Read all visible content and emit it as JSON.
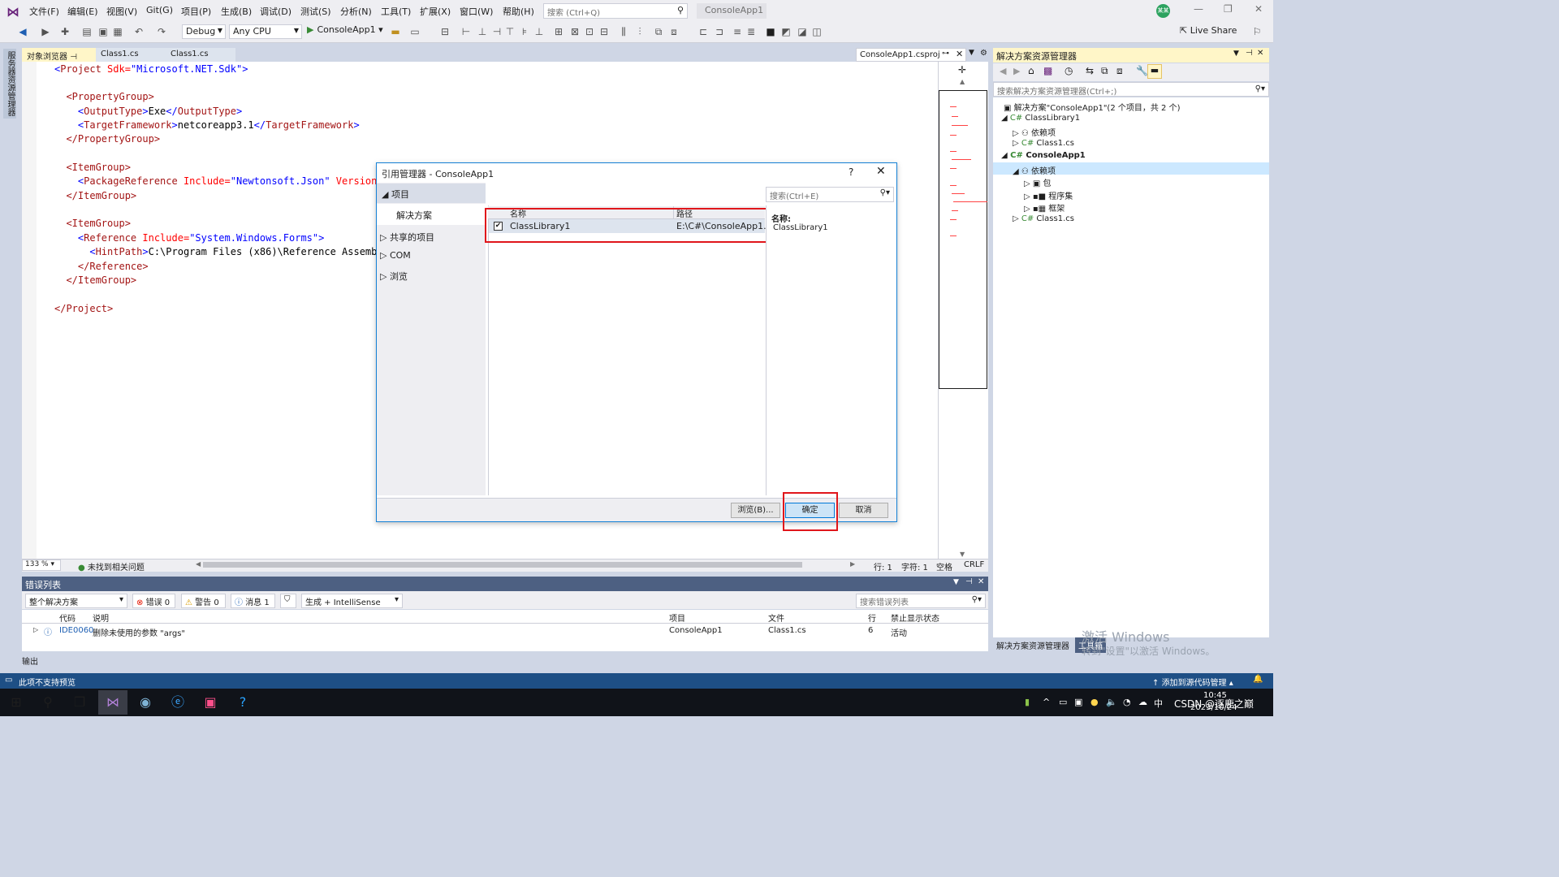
{
  "menu": {
    "items": [
      "文件(F)",
      "编辑(E)",
      "视图(V)",
      "Git(G)",
      "项目(P)",
      "生成(B)",
      "调试(D)",
      "测试(S)",
      "分析(N)",
      "工具(T)",
      "扩展(X)",
      "窗口(W)",
      "帮助(H)"
    ],
    "search_placeholder": "搜索 (Ctrl+Q)",
    "solution_name": "ConsoleApp1",
    "user_initials": "某某"
  },
  "toolbar": {
    "config": "Debug",
    "platform": "Any CPU",
    "start_label": "ConsoleApp1",
    "live_share": "Live Share"
  },
  "left_strip_label": "服务器资源管理器",
  "tabs": {
    "object_browser": "对象浏览器",
    "class1_a": "Class1.cs",
    "class1_b": "Class1.cs",
    "csproj": "ConsoleApp1.csproj"
  },
  "code": {
    "line1": {
      "open": "<",
      "tag": "Project",
      "attr": " Sdk=",
      "val": "\"Microsoft.NET.Sdk\"",
      "close": ">"
    },
    "line2": "  <PropertyGroup>",
    "line3_tag": "OutputType",
    "line3_val": "Exe",
    "line4_tag": "TargetFramework",
    "line4_val": "netcoreapp3.1",
    "line5": "  </PropertyGroup>",
    "line6": "  <ItemGroup>",
    "line7": {
      "tag": "PackageReference",
      "attr1": " Include=",
      "val1": "\"Newtonsoft.Json\"",
      "attr2": " Version="
    },
    "line8": "  </ItemGroup>",
    "line9": "  <ItemGroup>",
    "line10": {
      "tag": "Reference",
      "attr": " Include=",
      "val": "\"System.Windows.Forms\""
    },
    "line11_tag": "HintPath",
    "line11_val": "C:\\Program Files (x86)\\Reference Assembl",
    "line12": "    </Reference>",
    "line13": "  </ItemGroup>",
    "line14": "</Project>"
  },
  "editor_status": {
    "zoom": "133 %",
    "issues": "未找到相关问题",
    "line": "行: 1",
    "char": "字符: 1",
    "space": "空格",
    "eol": "CRLF"
  },
  "dialog": {
    "title": "引用管理器 - ConsoleApp1",
    "help": "?",
    "nav": {
      "projects": "项目",
      "solution": "解决方案",
      "shared": "共享的项目",
      "com": "COM",
      "browse": "浏览"
    },
    "search_placeholder": "搜索(Ctrl+E)",
    "columns": {
      "name": "名称",
      "path": "路径"
    },
    "row": {
      "name": "ClassLibrary1",
      "path": "E:\\C#\\ConsoleApp1...",
      "checked": true
    },
    "detail_label": "名称:",
    "detail_value": "ClassLibrary1",
    "buttons": {
      "browse": "浏览(B)...",
      "ok": "确定",
      "cancel": "取消"
    }
  },
  "errlist": {
    "title": "错误列表",
    "scope": "整个解决方案",
    "errors": "错误 0",
    "warnings": "警告 0",
    "messages": "消息 1",
    "build": "生成 + IntelliSense",
    "search_placeholder": "搜索错误列表",
    "headers": {
      "code": "代码",
      "desc": "说明",
      "project": "项目",
      "file": "文件",
      "line": "行",
      "suppress": "禁止显示状态"
    },
    "row": {
      "code": "IDE0060",
      "desc": "删除未使用的参数 \"args\"",
      "project": "ConsoleApp1",
      "file": "Class1.cs",
      "line": "6",
      "suppress": "活动"
    },
    "output_tab": "输出"
  },
  "solution_explorer": {
    "title": "解决方案资源管理器",
    "search_placeholder": "搜索解决方案资源管理器(Ctrl+;)",
    "solution": "解决方案\"ConsoleApp1\"(2 个项目，共 2 个)",
    "lib": "ClassLibrary1",
    "lib_deps": "依赖项",
    "lib_file": "Class1.cs",
    "app": "ConsoleApp1",
    "app_deps": "依赖项",
    "pkg": "包",
    "assemblies": "程序集",
    "frameworks": "框架",
    "app_file": "Class1.cs",
    "tab_se": "解决方案资源管理器",
    "tab_toolbox": "工具箱"
  },
  "watermark": {
    "line1": "激活 Windows",
    "line2": "转到\"设置\"以激活 Windows。"
  },
  "statusbar": {
    "left": "此项不支持预览",
    "right": "添加到源代码管理"
  },
  "taskbar": {
    "time": "10:45",
    "date": "2023/10/24",
    "csdn": "CSDN @逐鹿之巅",
    "ime": "中"
  }
}
